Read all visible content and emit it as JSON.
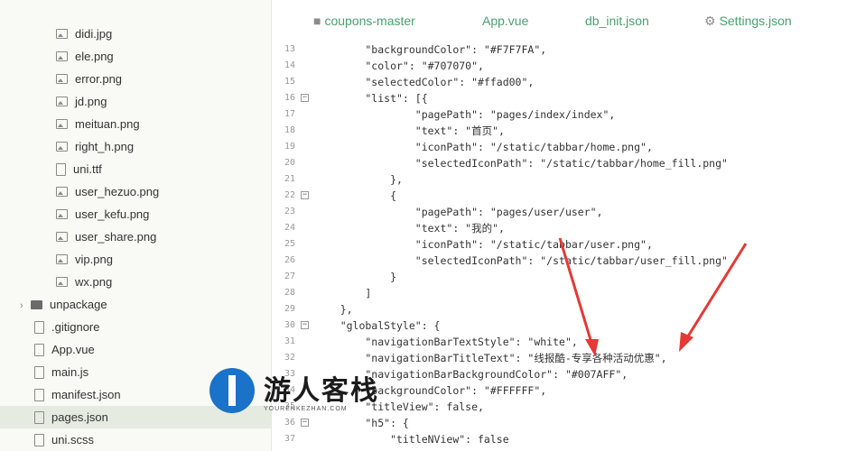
{
  "sidebar": {
    "items": [
      {
        "label": "didi.jpg",
        "type": "image"
      },
      {
        "label": "ele.png",
        "type": "image"
      },
      {
        "label": "error.png",
        "type": "image"
      },
      {
        "label": "jd.png",
        "type": "image"
      },
      {
        "label": "meituan.png",
        "type": "image"
      },
      {
        "label": "right_h.png",
        "type": "image"
      },
      {
        "label": "uni.ttf",
        "type": "file"
      },
      {
        "label": "user_hezuo.png",
        "type": "image"
      },
      {
        "label": "user_kefu.png",
        "type": "image"
      },
      {
        "label": "user_share.png",
        "type": "image"
      },
      {
        "label": "vip.png",
        "type": "image"
      },
      {
        "label": "wx.png",
        "type": "image"
      },
      {
        "label": "unpackage",
        "type": "folder"
      },
      {
        "label": ".gitignore",
        "type": "file"
      },
      {
        "label": "App.vue",
        "type": "file"
      },
      {
        "label": "main.js",
        "type": "file"
      },
      {
        "label": "manifest.json",
        "type": "file"
      },
      {
        "label": "pages.json",
        "type": "file",
        "selected": true
      },
      {
        "label": "uni.scss",
        "type": "file"
      }
    ]
  },
  "tabs": [
    {
      "label": "coupons-master",
      "icon": "folder-icon"
    },
    {
      "label": "App.vue",
      "icon": ""
    },
    {
      "label": "db_init.json",
      "icon": ""
    },
    {
      "label": "Settings.json",
      "icon": "gear-icon"
    }
  ],
  "editor": {
    "lines": [
      {
        "n": "13",
        "code": "        \"backgroundColor\": \"#F7F7FA\","
      },
      {
        "n": "14",
        "code": "        \"color\": \"#707070\","
      },
      {
        "n": "15",
        "code": "        \"selectedColor\": \"#ffad00\","
      },
      {
        "n": "16",
        "code": "        \"list\": [{",
        "fold": true
      },
      {
        "n": "17",
        "code": "                \"pagePath\": \"pages/index/index\","
      },
      {
        "n": "18",
        "code": "                \"text\": \"首页\","
      },
      {
        "n": "19",
        "code": "                \"iconPath\": \"/static/tabbar/home.png\","
      },
      {
        "n": "20",
        "code": "                \"selectedIconPath\": \"/static/tabbar/home_fill.png\""
      },
      {
        "n": "21",
        "code": "            },"
      },
      {
        "n": "22",
        "code": "            {",
        "fold": true
      },
      {
        "n": "23",
        "code": "                \"pagePath\": \"pages/user/user\","
      },
      {
        "n": "24",
        "code": "                \"text\": \"我的\","
      },
      {
        "n": "25",
        "code": "                \"iconPath\": \"/static/tabbar/user.png\","
      },
      {
        "n": "26",
        "code": "                \"selectedIconPath\": \"/static/tabbar/user_fill.png\""
      },
      {
        "n": "27",
        "code": "            }"
      },
      {
        "n": "28",
        "code": "        ]"
      },
      {
        "n": "29",
        "code": "    },"
      },
      {
        "n": "30",
        "code": "    \"globalStyle\": {",
        "fold": true
      },
      {
        "n": "31",
        "code": "        \"navigationBarTextStyle\": \"white\","
      },
      {
        "n": "32",
        "code": "        \"navigationBarTitleText\": \"线报酷-专享各种活动优惠\","
      },
      {
        "n": "33",
        "code": "        \"navigationBarBackgroundColor\": \"#007AFF\","
      },
      {
        "n": "34",
        "code": "        \"backgroundColor\": \"#FFFFFF\","
      },
      {
        "n": "35",
        "code": "        \"titleView\": false,"
      },
      {
        "n": "36",
        "code": "        \"h5\": {",
        "fold": true
      },
      {
        "n": "37",
        "code": "            \"titleNView\": false"
      }
    ]
  },
  "watermark": {
    "title": "游人客栈",
    "subtitle": "YOURENKEZHAN.COM"
  },
  "colors": {
    "accent_green": "#4aa06e",
    "arrow_red": "#e53935",
    "underline_blue": "#1e88e5",
    "underline_orange": "#e6a23c"
  }
}
